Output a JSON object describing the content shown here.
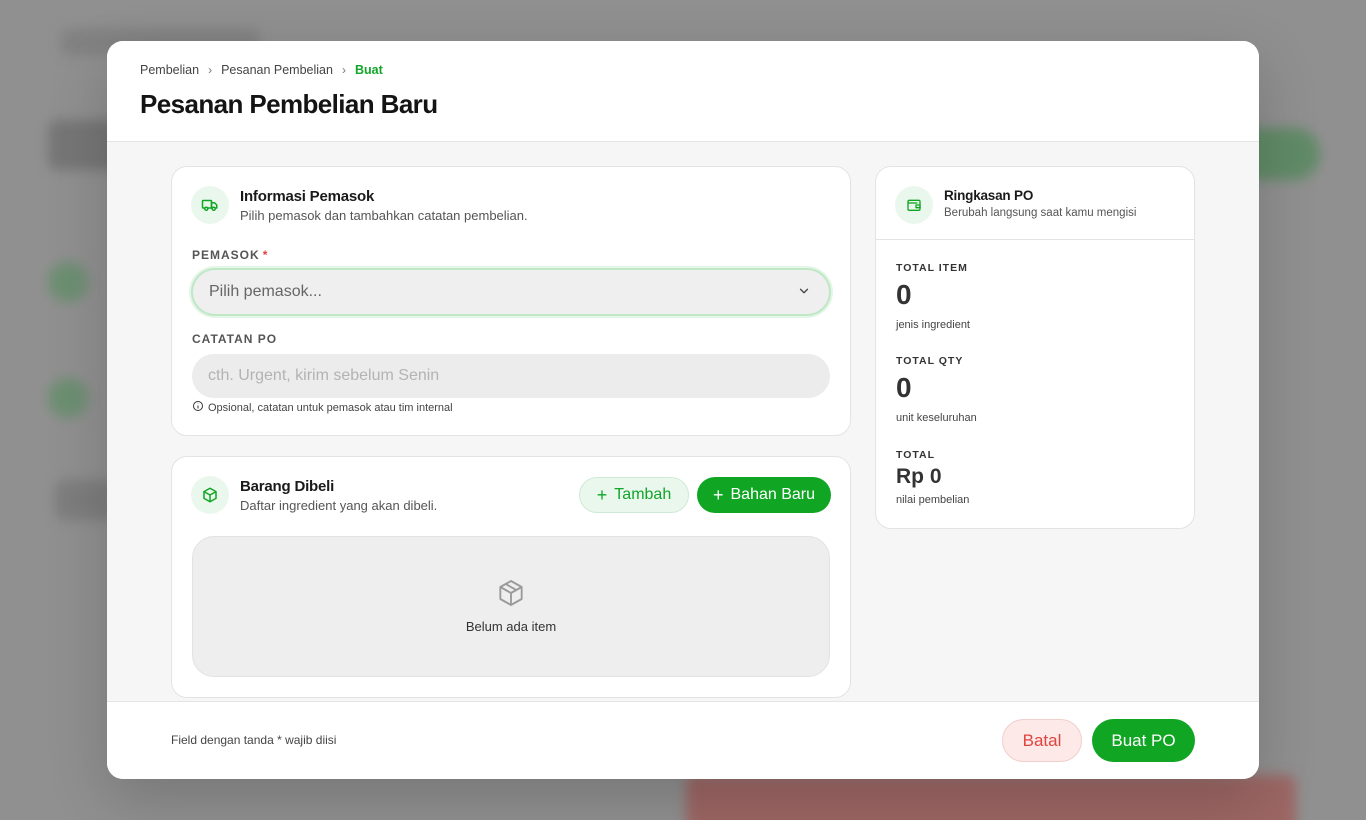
{
  "breadcrumb": [
    "Pembelian",
    "Pesanan Pembelian",
    "Buat"
  ],
  "page_title": "Pesanan Pembelian Baru",
  "supplier_card": {
    "icon": "truck-icon",
    "title": "Informasi Pemasok",
    "subtitle": "Pilih pemasok dan tambahkan catatan pembelian.",
    "supplier_label": "PEMASOK",
    "required_mark": "*",
    "supplier_placeholder": "Pilih pemasok...",
    "notes_label": "CATATAN PO",
    "notes_placeholder": "cth. Urgent, kirim sebelum Senin",
    "notes_value": "",
    "notes_hint": "Opsional, catatan untuk pemasok atau tim internal"
  },
  "items_card": {
    "icon": "box-icon",
    "title": "Barang Dibeli",
    "subtitle": "Daftar ingredient yang akan dibeli.",
    "add_label": "Tambah",
    "new_ingredient_label": "Bahan Baru",
    "empty_text": "Belum ada item"
  },
  "summary_card": {
    "icon": "wallet-icon",
    "title": "Ringkasan PO",
    "subtitle": "Berubah langsung saat kamu mengisi",
    "total_item_label": "TOTAL ITEM",
    "total_item_value": "0",
    "total_item_sub": "jenis ingredient",
    "total_qty_label": "TOTAL QTY",
    "total_qty_value": "0",
    "total_qty_sub": "unit keseluruhan",
    "total_label": "TOTAL",
    "total_value": "Rp 0",
    "total_sub": "nilai pembelian"
  },
  "footer": {
    "note": "Field dengan tanda * wajib diisi",
    "cancel_label": "Batal",
    "submit_label": "Buat PO"
  },
  "colors": {
    "accent": "#10a624",
    "danger": "#e0443e"
  }
}
